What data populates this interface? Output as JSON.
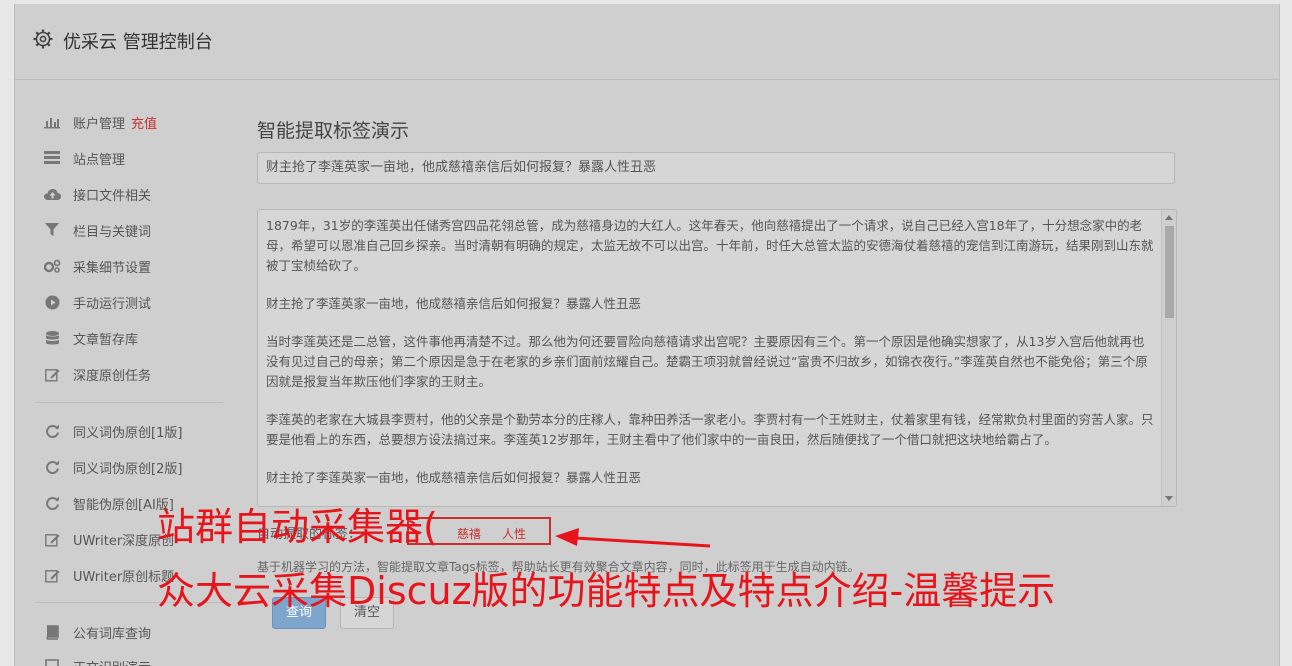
{
  "header": {
    "title": "优采云 管理控制台"
  },
  "sidebar": {
    "items": [
      {
        "label": "账户管理",
        "badge": "充值",
        "icon": "bar-chart-icon"
      },
      {
        "label": "站点管理",
        "icon": "list-icon"
      },
      {
        "label": "接口文件相关",
        "icon": "cloud-upload-icon"
      },
      {
        "label": "栏目与关键词",
        "icon": "filter-icon"
      },
      {
        "label": "采集细节设置",
        "icon": "gears-icon"
      },
      {
        "label": "手动运行测试",
        "icon": "play-circle-icon"
      },
      {
        "label": "文章暂存库",
        "icon": "database-icon"
      },
      {
        "label": "深度原创任务",
        "icon": "edit-icon"
      },
      {
        "label": "同义词伪原创[1版]",
        "icon": "refresh-icon"
      },
      {
        "label": "同义词伪原创[2版]",
        "icon": "refresh-icon"
      },
      {
        "label": "智能伪原创[AI版]",
        "icon": "refresh-icon"
      },
      {
        "label": "UWriter深度原创",
        "icon": "edit-icon"
      },
      {
        "label": "UWriter原创标题",
        "icon": "edit-icon"
      },
      {
        "label": "公有词库查询",
        "icon": "book-icon"
      },
      {
        "label": "正文识别演示",
        "icon": "square-icon"
      }
    ]
  },
  "main": {
    "heading": "智能提取标签演示",
    "title_value": "财主抢了李莲英家一亩地，他成慈禧亲信后如何报复？暴露人性丑恶",
    "content": {
      "paragraphs": [
        "1879年，31岁的李莲英出任储秀宫四品花翎总管，成为慈禧身边的大红人。这年春天，他向慈禧提出了一个请求，说自己已经入宫18年了，十分想念家中的老母，希望可以恩准自己回乡探亲。当时清朝有明确的规定，太监无故不可以出宫。十年前，时任大总管太监的安德海仗着慈禧的宠信到江南游玩，结果刚到山东就被丁宝桢给砍了。",
        "财主抢了李莲英家一亩地，他成慈禧亲信后如何报复？暴露人性丑恶",
        "当时李莲英还是二总管，这件事他再清楚不过。那么他为何还要冒险向慈禧请求出宫呢？主要原因有三个。第一个原因是他确实想家了，从13岁入宫后他就再也没有见过自己的母亲；第二个原因是急于在老家的乡亲们面前炫耀自己。楚霸王项羽就曾经说过“富贵不归故乡，如锦衣夜行。”李莲英自然也不能免俗；第三个原因就是报复当年欺压他们李家的王财主。",
        "李莲英的老家在大城县李贾村，他的父亲是个勤劳本分的庄稼人，靠种田养活一家老小。李贾村有一个王姓财主，仗着家里有钱，经常欺负村里面的穷苦人家。只要是他看上的东西，总要想方设法搞过来。李莲英12岁那年，王财主看中了他们家中的一亩良田，然后随便找了一个借口就把这块地给霸占了。",
        "财主抢了李莲英家一亩地，他成慈禧亲信后如何报复？暴露人性丑恶"
      ]
    },
    "tags_label": "自动提取的标签：",
    "tags": [
      "慈禧",
      "人性"
    ],
    "hint": "基于机器学习的方法，智能提取文章Tags标签，帮助站长更有效聚合文章内容，同时，此标签用于生成自动内链。",
    "buttons": {
      "query": "查询",
      "clear": "清空"
    }
  },
  "overlay": {
    "line1": "站群自动采集器(",
    "line2": "众大云采集Discuz版的功能特点及特点介绍-温馨提示",
    "color": "#e8141b"
  }
}
